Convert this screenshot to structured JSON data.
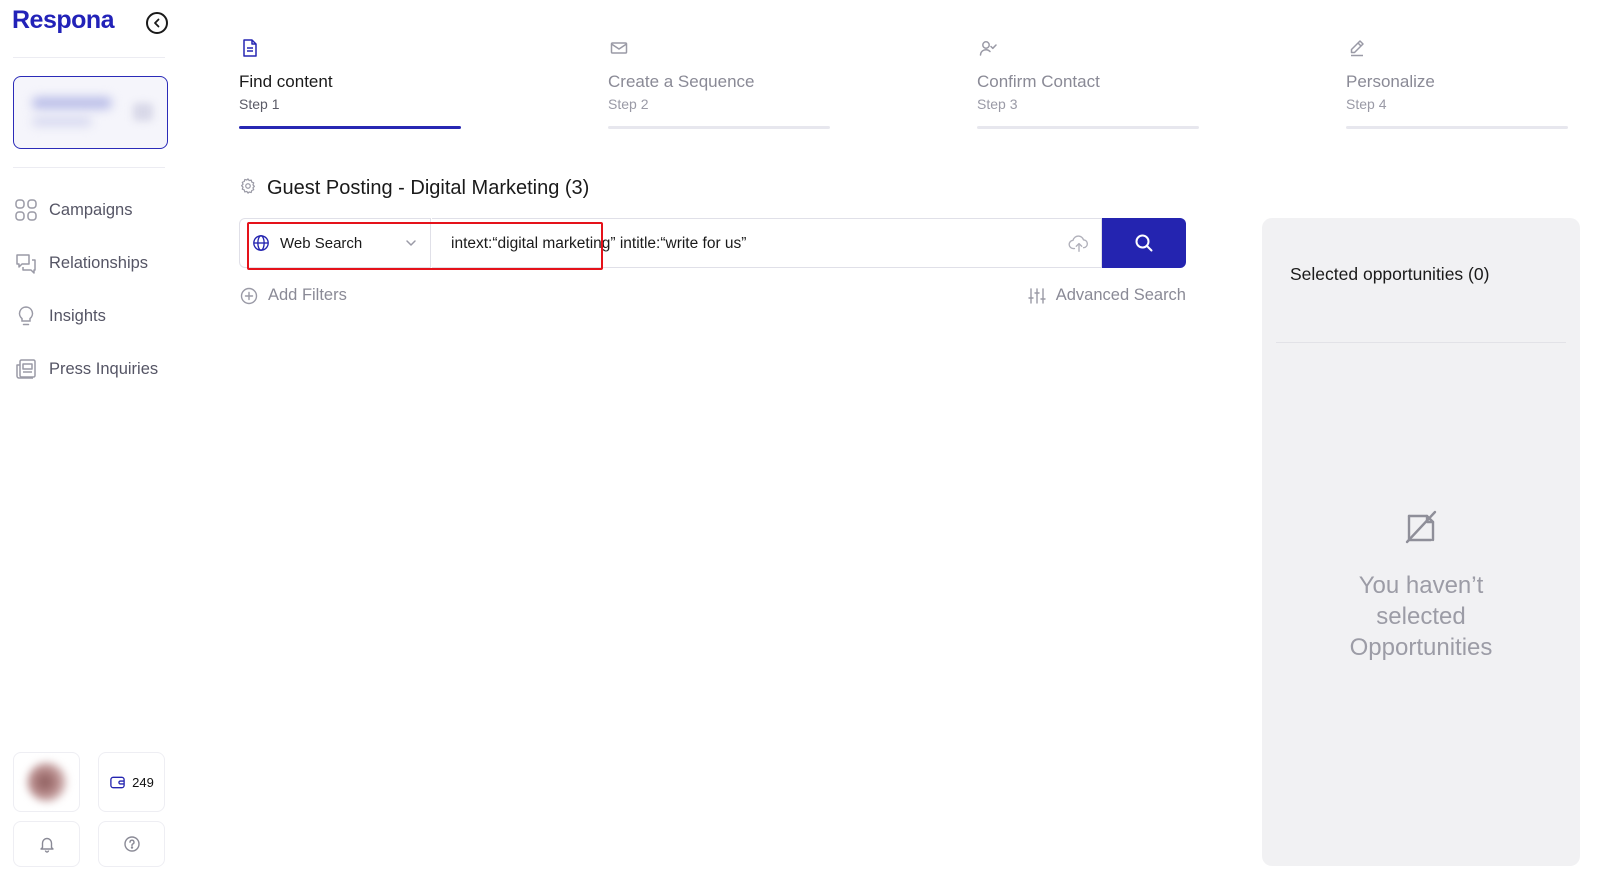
{
  "app": {
    "name": "Respona"
  },
  "sidebar": {
    "nav": [
      {
        "label": "Campaigns",
        "icon": "grid-icon"
      },
      {
        "label": "Relationships",
        "icon": "chat-icon"
      },
      {
        "label": "Insights",
        "icon": "lightbulb-icon"
      },
      {
        "label": "Press Inquiries",
        "icon": "press-icon"
      }
    ],
    "credits": "249"
  },
  "steps": [
    {
      "title": "Find content",
      "subtitle": "Step 1",
      "icon": "document-icon",
      "active": true
    },
    {
      "title": "Create a Sequence",
      "subtitle": "Step 2",
      "icon": "envelope-icon",
      "active": false
    },
    {
      "title": "Confirm Contact",
      "subtitle": "Step 3",
      "icon": "user-check-icon",
      "active": false
    },
    {
      "title": "Personalize",
      "subtitle": "Step 4",
      "icon": "pen-icon",
      "active": false
    }
  ],
  "campaign": {
    "title": "Guest Posting - Digital Marketing (3)"
  },
  "search": {
    "source": "Web Search",
    "query": "intext:“digital marketing” intitle:“write for us”"
  },
  "filters": {
    "add_label": "Add Filters",
    "advanced_label": "Advanced Search"
  },
  "selected_panel": {
    "title": "Selected opportunities (0)",
    "empty_message": "You haven’t selected Opportunities"
  },
  "colors": {
    "brand": "#2424b0",
    "highlight": "#e5121a",
    "panel_bg": "#f1f1f3",
    "muted_text": "#8a8a96"
  }
}
